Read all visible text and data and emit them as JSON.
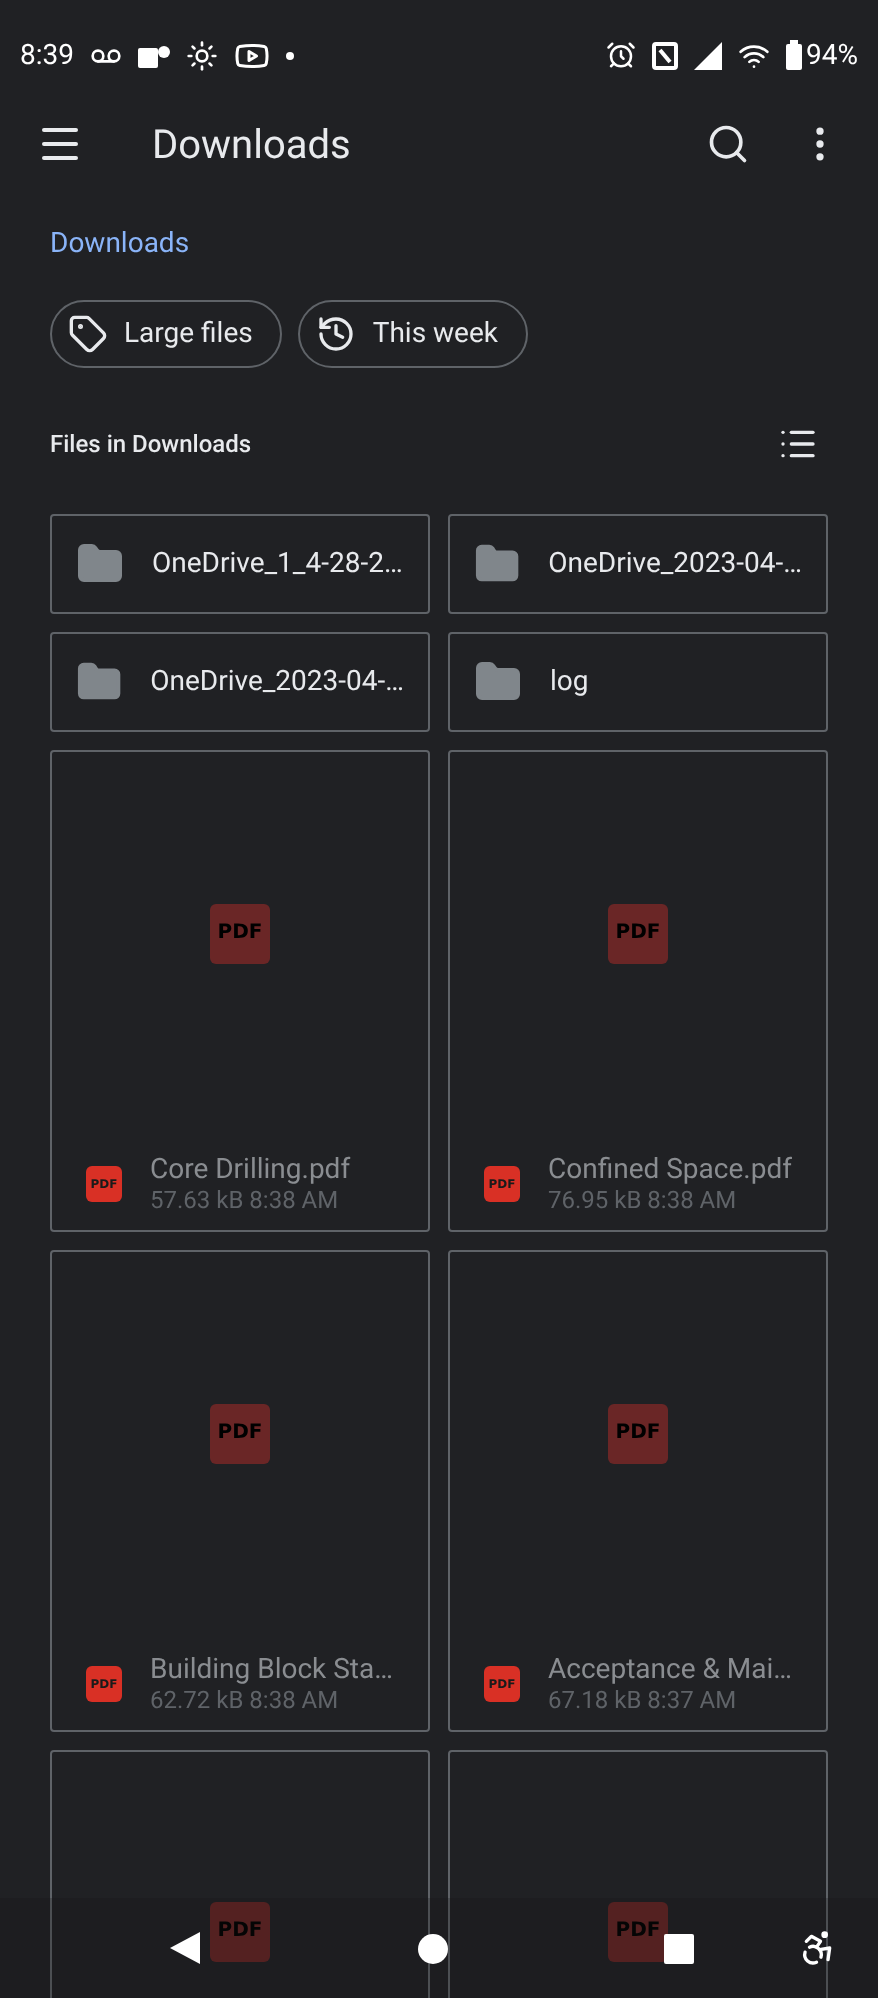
{
  "status_bar": {
    "time": "8:39",
    "battery": "94%"
  },
  "app_bar": {
    "title": "Downloads"
  },
  "breadcrumb": "Downloads",
  "chips": [
    {
      "kind": "tag",
      "label": "Large files"
    },
    {
      "kind": "history",
      "label": "This week"
    }
  ],
  "section": {
    "title": "Files in Downloads"
  },
  "folders": [
    {
      "name": "OneDrive_1_4-28-2…"
    },
    {
      "name": "OneDrive_2023-04-…"
    },
    {
      "name": "OneDrive_2023-04-…"
    },
    {
      "name": "log"
    }
  ],
  "files": [
    {
      "thumb_label": "PDF",
      "icon_label": "PDF",
      "name": "Core Drilling.pdf",
      "size": "57.63 kB",
      "time": "8:38 AM"
    },
    {
      "thumb_label": "PDF",
      "icon_label": "PDF",
      "name": "Confined Space.pdf",
      "size": "76.95 kB",
      "time": "8:38 AM"
    },
    {
      "thumb_label": "PDF",
      "icon_label": "PDF",
      "name": "Building Block Sta…",
      "size": "62.72 kB",
      "time": "8:38 AM"
    },
    {
      "thumb_label": "PDF",
      "icon_label": "PDF",
      "name": "Acceptance & Mai…",
      "size": "67.18 kB",
      "time": "8:37 AM"
    },
    {
      "thumb_label": "PDF"
    },
    {
      "thumb_label": "PDF"
    }
  ]
}
